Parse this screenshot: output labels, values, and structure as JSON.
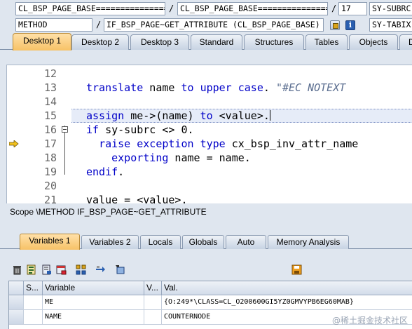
{
  "info_row1": {
    "field1": "CL_BSP_PAGE_BASE===============",
    "sep1": "/",
    "field2": "CL_BSP_PAGE_BASE===============",
    "sep2": "/",
    "line": "17",
    "sysfield": "SY-SUBRC"
  },
  "info_row2": {
    "type": "METHOD",
    "sep": "/",
    "method": "IF_BSP_PAGE~GET_ATTRIBUTE (CL_BSP_PAGE_BASE)",
    "sysfield": "SY-TABIX"
  },
  "desktop_tabs": [
    "Desktop 1",
    "Desktop 2",
    "Desktop 3",
    "Standard",
    "Structures",
    "Tables",
    "Objects",
    "D"
  ],
  "code": {
    "lines": [
      {
        "no": "12",
        "text": ""
      },
      {
        "no": "13",
        "parts": [
          [
            "kw",
            "translate"
          ],
          [
            "txt",
            " name "
          ],
          [
            "kw",
            "to"
          ],
          [
            "txt",
            " "
          ],
          [
            "kw",
            "upper"
          ],
          [
            "txt",
            " "
          ],
          [
            "kw",
            "case"
          ],
          [
            "txt",
            ". "
          ],
          [
            "str",
            "\"#EC NOTEXT"
          ]
        ]
      },
      {
        "no": "14",
        "text": ""
      },
      {
        "no": "15",
        "parts": [
          [
            "kw",
            "assign"
          ],
          [
            "txt",
            " me->(name) "
          ],
          [
            "kw",
            "to"
          ],
          [
            "txt",
            " <value>."
          ]
        ]
      },
      {
        "no": "16",
        "parts": [
          [
            "kw",
            "if"
          ],
          [
            "txt",
            " sy-subrc <> 0."
          ]
        ]
      },
      {
        "no": "17",
        "parts": [
          [
            "txt",
            "  "
          ],
          [
            "kw",
            "raise"
          ],
          [
            "txt",
            " "
          ],
          [
            "kw",
            "exception"
          ],
          [
            "txt",
            " "
          ],
          [
            "kw",
            "type"
          ],
          [
            "txt",
            " cx_bsp_inv_attr_name"
          ]
        ]
      },
      {
        "no": "18",
        "parts": [
          [
            "txt",
            "    "
          ],
          [
            "kw",
            "exporting"
          ],
          [
            "txt",
            " name = name."
          ]
        ]
      },
      {
        "no": "19",
        "parts": [
          [
            "kw",
            "endif"
          ],
          [
            "txt",
            "."
          ]
        ]
      },
      {
        "no": "20",
        "text": ""
      },
      {
        "no": "21",
        "parts": [
          [
            "txt",
            "value = <value>."
          ]
        ]
      }
    ]
  },
  "scope": "Scope \\METHOD IF_BSP_PAGE~GET_ATTRIBUTE",
  "var_tabs": [
    "Variables 1",
    "Variables 2",
    "Locals",
    "Globals",
    "Auto",
    "Memory Analysis"
  ],
  "table": {
    "headers": [
      "S...",
      "Variable",
      "V...",
      "Val."
    ],
    "rows": [
      {
        "var": "ME",
        "val": "{O:249*\\CLASS=CL_O200600GI5YZ0GMVYPB6EG60MAB}"
      },
      {
        "var": "NAME",
        "val": "COUNTERNODE"
      }
    ]
  },
  "watermark": "@稀土掘金技术社区",
  "colors": {
    "keyword": "#0000c8",
    "comment": "#5b6e90",
    "active_tab": "#f7c266",
    "background": "#dfe6ef"
  }
}
